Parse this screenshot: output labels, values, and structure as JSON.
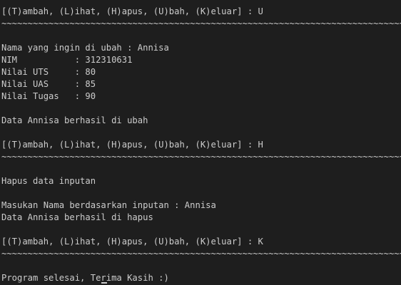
{
  "terminal": {
    "lines": [
      "[(T)ambah, (L)ihat, (H)apus, (U)bah, (K)eluar] : U",
      "~~~~~~~~~~~~~~~~~~~~~~~~~~~~~~~~~~~~~~~~~~~~~~~~~~~~~~~~~~~~~~~~~~~~~~~~~~~~~~~~~~~~~~~~~~~~~~~",
      "",
      "Nama yang ingin di ubah : Annisa",
      "NIM           : 312310631",
      "Nilai UTS     : 80",
      "Nilai UAS     : 85",
      "Nilai Tugas   : 90",
      "",
      "Data Annisa berhasil di ubah",
      "",
      "[(T)ambah, (L)ihat, (H)apus, (U)bah, (K)eluar] : H",
      "~~~~~~~~~~~~~~~~~~~~~~~~~~~~~~~~~~~~~~~~~~~~~~~~~~~~~~~~~~~~~~~~~~~~~~~~~~~~~~~~~~~~~~~~~~~~~~~",
      "",
      "Hapus data inputan",
      "",
      "Masukan Nama berdasarkan inputan : Annisa",
      "Data Annisa berhasil di hapus",
      "",
      "[(T)ambah, (L)ihat, (H)apus, (U)bah, (K)eluar] : K",
      "~~~~~~~~~~~~~~~~~~~~~~~~~~~~~~~~~~~~~~~~~~~~~~~~~~~~~~~~~~~~~~~~~~~~~~~~~~~~~~~~~~~~~~~~~~~~~~~",
      "",
      "Program selesai, Terima Kasih :)"
    ]
  },
  "colors": {
    "background": "#1e1e1e",
    "text": "#cccccc"
  }
}
